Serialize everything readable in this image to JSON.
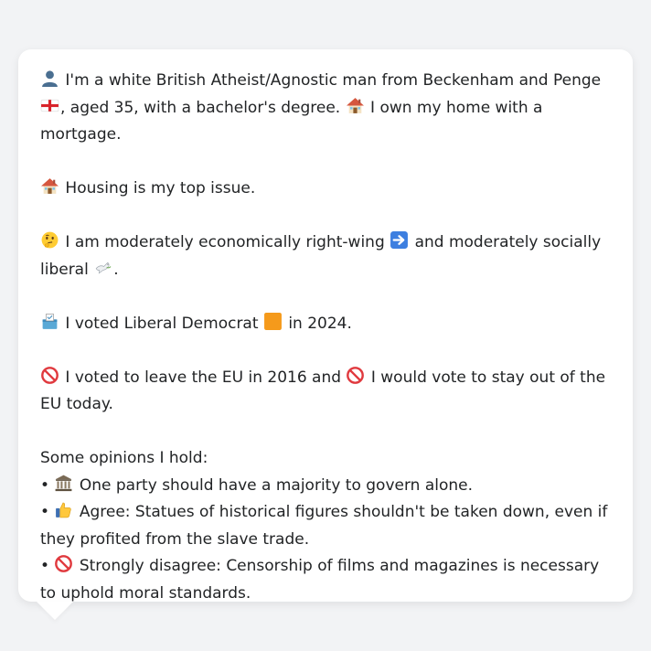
{
  "message": {
    "intro": {
      "text_a": "I'm a white British Atheist/Agnostic man from Beckenham and Penge",
      "text_b": ", aged 35, with a bachelor's degree.",
      "text_c": "I own my home with a mortgage."
    },
    "top_issue": "Housing is my top issue.",
    "ideology": {
      "text_a": "I am moderately economically right-wing",
      "text_b": "and moderately socially liberal",
      "text_c": "."
    },
    "vote_2024": {
      "text_a": "I voted Liberal Democrat",
      "text_b": "in 2024."
    },
    "eu": {
      "text_a": "I voted to leave the EU in 2016 and",
      "text_b": "I would vote to stay out of the EU today."
    },
    "opinions_heading": "Some opinions I hold:",
    "opinions": [
      {
        "bullet": "•",
        "icon": "classical-building-icon",
        "text": "One party should have a majority to govern alone."
      },
      {
        "bullet": "•",
        "icon": "thumbs-up-icon",
        "text": "Agree: Statues of historical figures shouldn't be taken down, even if they profited from the slave trade."
      },
      {
        "bullet": "•",
        "icon": "prohibited-icon",
        "text": "Strongly disagree: Censorship of films and magazines is necessary to uphold moral standards."
      }
    ]
  },
  "colors": {
    "background": "#f2f3f5",
    "bubble": "#ffffff",
    "text": "#222426",
    "lib_dem_orange": "#f59a1b",
    "prohibited_red": "#e0393e"
  }
}
